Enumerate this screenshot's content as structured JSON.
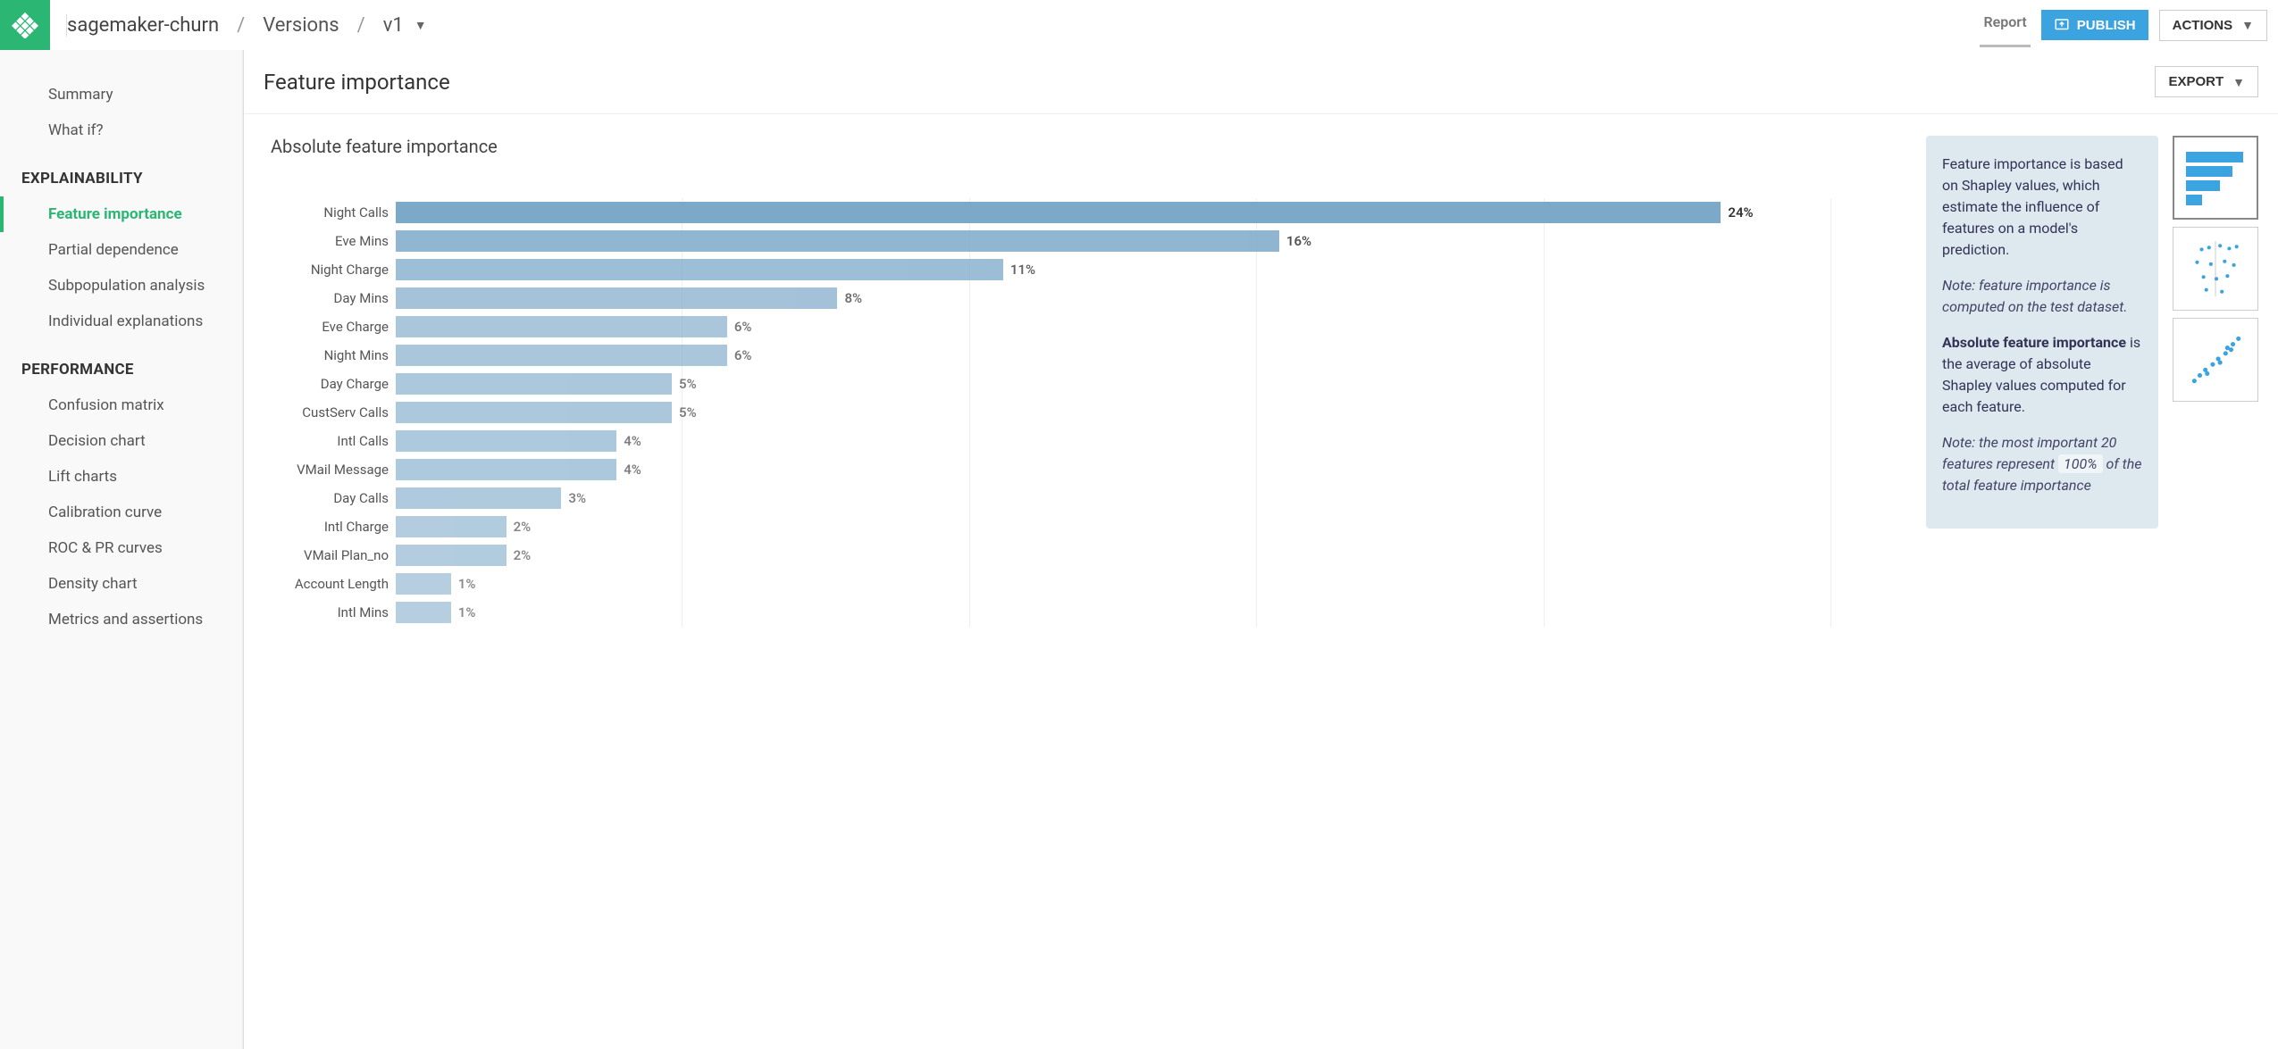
{
  "breadcrumb": {
    "app": "sagemaker-churn",
    "level2": "Versions",
    "version": "v1"
  },
  "topbar": {
    "report": "Report",
    "publish": "PUBLISH",
    "actions": "ACTIONS"
  },
  "sidebar": {
    "basic": [
      "Summary",
      "What if?"
    ],
    "explain_header": "EXPLAINABILITY",
    "explain": [
      "Feature importance",
      "Partial dependence",
      "Subpopulation analysis",
      "Individual explanations"
    ],
    "perf_header": "PERFORMANCE",
    "perf": [
      "Confusion matrix",
      "Decision chart",
      "Lift charts",
      "Calibration curve",
      "ROC & PR curves",
      "Density chart",
      "Metrics and assertions"
    ]
  },
  "page": {
    "title": "Feature importance",
    "export": "EXPORT",
    "chart_title": "Absolute feature importance"
  },
  "info": {
    "p1": "Feature importance is based on Shapley values, which estimate the influence of features on a model's prediction.",
    "note1": "Note: feature importance is computed on the test dataset.",
    "p2a": "Absolute feature importance",
    "p2b": " is the average of absolute Shapley values computed for each feature.",
    "note2a": "Note: the most important 20 features represent ",
    "note2pct": "100%",
    "note2b": " of the total feature importance"
  },
  "chart_data": {
    "type": "bar",
    "orientation": "horizontal",
    "title": "Absolute feature importance",
    "xlabel": "",
    "ylabel": "",
    "categories": [
      "Night Calls",
      "Eve Mins",
      "Night Charge",
      "Day Mins",
      "Eve Charge",
      "Night Mins",
      "Day Charge",
      "CustServ Calls",
      "Intl Calls",
      "VMail Message",
      "Day Calls",
      "Intl Charge",
      "VMail Plan_no",
      "Account Length",
      "Intl Mins"
    ],
    "values": [
      24,
      16,
      11,
      8,
      6,
      6,
      5,
      5,
      4,
      4,
      3,
      2,
      2,
      1,
      1
    ],
    "value_suffix": "%",
    "xlim": [
      0,
      26
    ],
    "color": "#7da9c9"
  }
}
